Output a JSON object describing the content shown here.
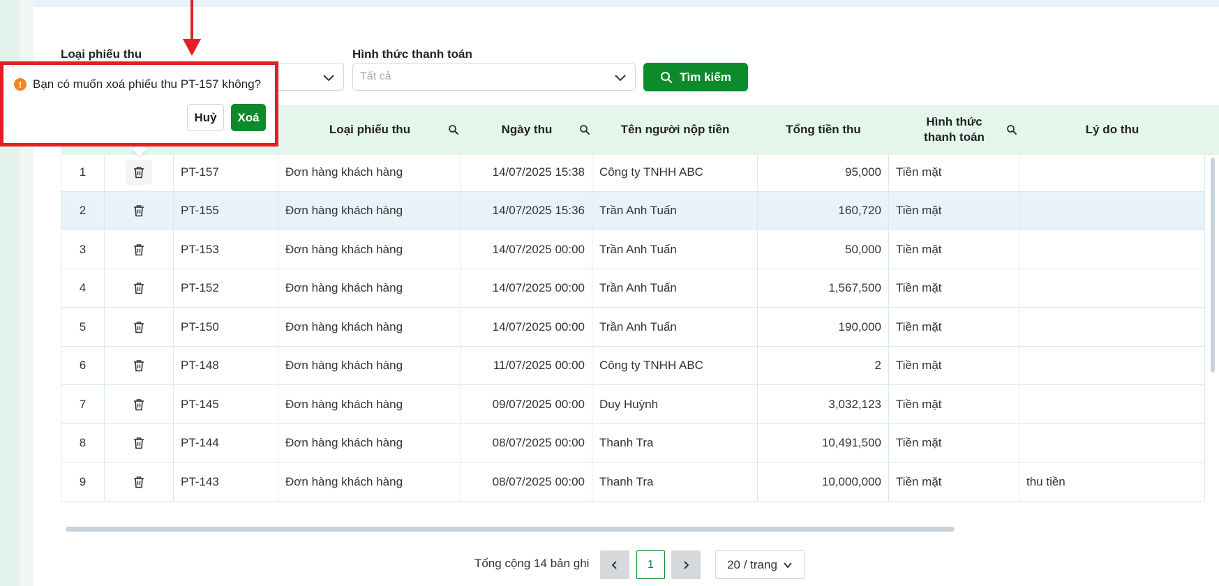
{
  "filters": {
    "receipt_type_label": "Loại phiếu thu",
    "payment_method_label": "Hình thức thanh toán",
    "payment_method_placeholder": "Tất cả",
    "search_button": "Tìm kiếm"
  },
  "table": {
    "columns": {
      "receipt_type": "Loại phiếu thu",
      "date": "Ngày thu",
      "payer": "Tên người nộp tiền",
      "total": "Tổng tiền thu",
      "method": "Hình thức thanh toán",
      "reason": "Lý do thu"
    },
    "rows": [
      {
        "stt": "1",
        "code": "PT-157",
        "type": "Đơn hàng khách hàng",
        "date": "14/07/2025 15:38",
        "payer": "Công ty TNHH ABC",
        "total": "95,000",
        "method": "Tiền mặt",
        "reason": ""
      },
      {
        "stt": "2",
        "code": "PT-155",
        "type": "Đơn hàng khách hàng",
        "date": "14/07/2025 15:36",
        "payer": "Trần Anh Tuấn",
        "total": "160,720",
        "method": "Tiền mặt",
        "reason": ""
      },
      {
        "stt": "3",
        "code": "PT-153",
        "type": "Đơn hàng khách hàng",
        "date": "14/07/2025 00:00",
        "payer": "Trần Anh Tuấn",
        "total": "50,000",
        "method": "Tiền mặt",
        "reason": ""
      },
      {
        "stt": "4",
        "code": "PT-152",
        "type": "Đơn hàng khách hàng",
        "date": "14/07/2025 00:00",
        "payer": "Trần Anh Tuấn",
        "total": "1,567,500",
        "method": "Tiền mặt",
        "reason": ""
      },
      {
        "stt": "5",
        "code": "PT-150",
        "type": "Đơn hàng khách hàng",
        "date": "14/07/2025 00:00",
        "payer": "Trần Anh Tuấn",
        "total": "190,000",
        "method": "Tiền mặt",
        "reason": ""
      },
      {
        "stt": "6",
        "code": "PT-148",
        "type": "Đơn hàng khách hàng",
        "date": "11/07/2025 00:00",
        "payer": "Công ty TNHH ABC",
        "total": "2",
        "method": "Tiền mặt",
        "reason": ""
      },
      {
        "stt": "7",
        "code": "PT-145",
        "type": "Đơn hàng khách hàng",
        "date": "09/07/2025 00:00",
        "payer": "Duy Huỳnh",
        "total": "3,032,123",
        "method": "Tiền mặt",
        "reason": ""
      },
      {
        "stt": "8",
        "code": "PT-144",
        "type": "Đơn hàng khách hàng",
        "date": "08/07/2025 00:00",
        "payer": "Thanh Tra",
        "total": "10,491,500",
        "method": "Tiền mặt",
        "reason": ""
      },
      {
        "stt": "9",
        "code": "PT-143",
        "type": "Đơn hàng khách hàng",
        "date": "08/07/2025 00:00",
        "payer": "Thanh Tra",
        "total": "10,000,000",
        "method": "Tiền mặt",
        "reason": "thu tiền"
      }
    ]
  },
  "pagination": {
    "total_text": "Tổng cộng 14 bản ghi",
    "current_page": "1",
    "page_size": "20 / trang"
  },
  "confirm": {
    "message": "Bạn có muốn xoá phiếu thu PT-157 không?",
    "cancel": "Huỷ",
    "delete": "Xoá"
  },
  "colors": {
    "primary": "#0d8a2b",
    "header_bg": "#e4f5ec",
    "highlight": "#e31e24",
    "warning": "#f5841f"
  }
}
